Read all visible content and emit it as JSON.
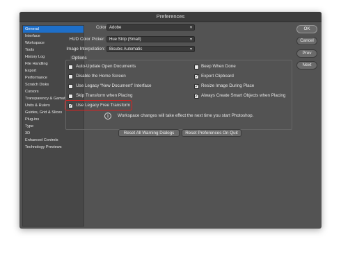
{
  "window": {
    "title": "Preferences"
  },
  "sidebar": {
    "items": [
      {
        "label": "General",
        "selected": true
      },
      {
        "label": "Interface"
      },
      {
        "label": "Workspace"
      },
      {
        "label": "Tools"
      },
      {
        "label": "History Log"
      },
      {
        "label": "File Handling"
      },
      {
        "label": "Export"
      },
      {
        "label": "Performance"
      },
      {
        "label": "Scratch Disks"
      },
      {
        "label": "Cursors"
      },
      {
        "label": "Transparency & Gamut"
      },
      {
        "label": "Units & Rulers"
      },
      {
        "label": "Guides, Grid & Slices"
      },
      {
        "label": "Plug-ins"
      },
      {
        "label": "Type"
      },
      {
        "label": "3D"
      },
      {
        "label": "Enhanced Controls"
      },
      {
        "label": "Technology Previews"
      }
    ]
  },
  "general": {
    "color_picker": {
      "label": "Color Picker:",
      "value": "Adobe"
    },
    "hud_color_picker": {
      "label": "HUD Color Picker:",
      "value": "Hue Strip (Small)"
    },
    "interpolation": {
      "label": "Image Interpolation:",
      "value": "Bicubic Automatic"
    }
  },
  "options": {
    "title": "Options",
    "left": [
      {
        "label": "Auto-Update Open Documents",
        "checked": false
      },
      {
        "label": "Disable the Home Screen",
        "checked": false
      },
      {
        "label": "Use Legacy “New Document” Interface",
        "checked": false
      },
      {
        "label": "Skip Transform when Placing",
        "checked": false
      },
      {
        "label": "Use Legacy Free Transform",
        "checked": true
      }
    ],
    "right": [
      {
        "label": "Beep When Done",
        "checked": false
      },
      {
        "label": "Export Clipboard",
        "checked": true
      },
      {
        "label": "Resize Image During Place",
        "checked": true
      },
      {
        "label": "Always Create Smart Objects when Placing",
        "checked": true
      }
    ],
    "note": "Workspace changes will take effect the next time you start Photoshop."
  },
  "buttons": {
    "reset_warnings": "Reset All Warning Dialogs",
    "reset_prefs": "Reset Preferences On Quit",
    "ok": "OK",
    "cancel": "Cancel",
    "prev": "Prev",
    "next": "Next"
  },
  "colors": {
    "accent": "#1e6fc9",
    "highlight": "#e0201f",
    "panel": "#535353"
  }
}
